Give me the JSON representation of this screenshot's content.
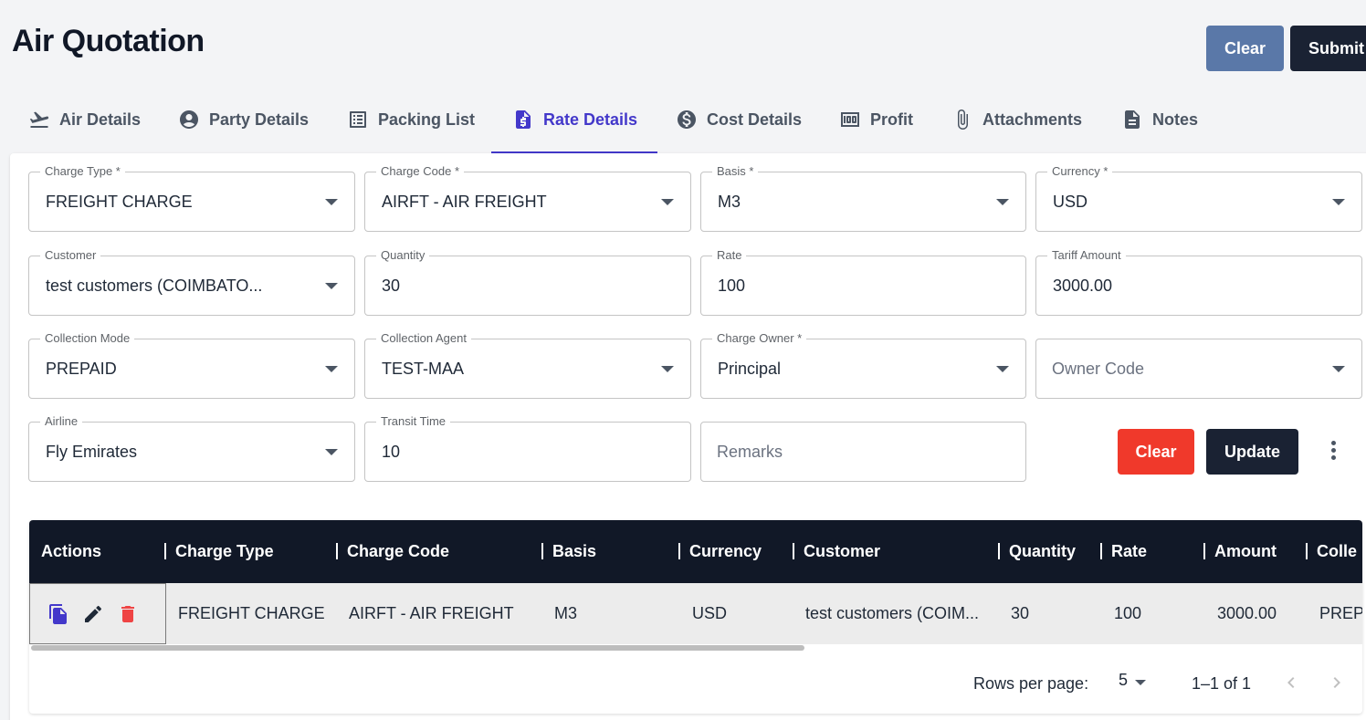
{
  "page": {
    "title": "Air Quotation"
  },
  "header": {
    "clear_label": "Clear",
    "submit_label": "Submit"
  },
  "tabs": [
    {
      "label": "Air Details",
      "icon": "airplane-takeoff-icon"
    },
    {
      "label": "Party Details",
      "icon": "account-circle-icon"
    },
    {
      "label": "Packing List",
      "icon": "list-icon"
    },
    {
      "label": "Rate Details",
      "icon": "dollar-document-icon",
      "active": true
    },
    {
      "label": "Cost Details",
      "icon": "dollar-circle-icon"
    },
    {
      "label": "Profit",
      "icon": "money-icon"
    },
    {
      "label": "Attachments",
      "icon": "paperclip-icon"
    },
    {
      "label": "Notes",
      "icon": "document-icon"
    }
  ],
  "form": {
    "charge_type": {
      "label": "Charge Type *",
      "value": "FREIGHT CHARGE"
    },
    "charge_code": {
      "label": "Charge Code *",
      "value": "AIRFT - AIR FREIGHT"
    },
    "basis": {
      "label": "Basis *",
      "value": "M3"
    },
    "currency": {
      "label": "Currency *",
      "value": "USD"
    },
    "customer": {
      "label": "Customer",
      "value": "test customers (COIMBATO..."
    },
    "quantity": {
      "label": "Quantity",
      "value": "30"
    },
    "rate": {
      "label": "Rate",
      "value": "100"
    },
    "tariff_amount": {
      "label": "Tariff Amount",
      "value": "3000.00"
    },
    "collection_mode": {
      "label": "Collection Mode",
      "value": "PREPAID"
    },
    "collection_agent": {
      "label": "Collection Agent",
      "value": "TEST-MAA"
    },
    "charge_owner": {
      "label": "Charge Owner *",
      "value": "Principal"
    },
    "owner_code": {
      "placeholder": "Owner Code"
    },
    "airline": {
      "label": "Airline",
      "value": "Fly Emirates"
    },
    "transit_time": {
      "label": "Transit Time",
      "value": "10"
    },
    "remarks": {
      "placeholder": "Remarks"
    },
    "clear_label": "Clear",
    "update_label": "Update"
  },
  "table": {
    "columns": [
      "Actions",
      "Charge Type",
      "Charge Code",
      "Basis",
      "Currency",
      "Customer",
      "Quantity",
      "Rate",
      "Amount",
      "Colle"
    ],
    "rows": [
      {
        "charge_type": "FREIGHT CHARGE",
        "charge_code": "AIRFT - AIR FREIGHT",
        "basis": "M3",
        "currency": "USD",
        "customer": "test customers (COIM...",
        "quantity": "30",
        "rate": "100",
        "amount": "3000.00",
        "collection": "PREPA"
      }
    ],
    "footer": {
      "rows_per_page_label": "Rows per page:",
      "rows_per_page": "5",
      "range": "1–1 of 1"
    }
  },
  "colors": {
    "accent": "#4338ca",
    "dark": "#111827",
    "danger": "#f0392b",
    "clear": "#5a78a8"
  }
}
